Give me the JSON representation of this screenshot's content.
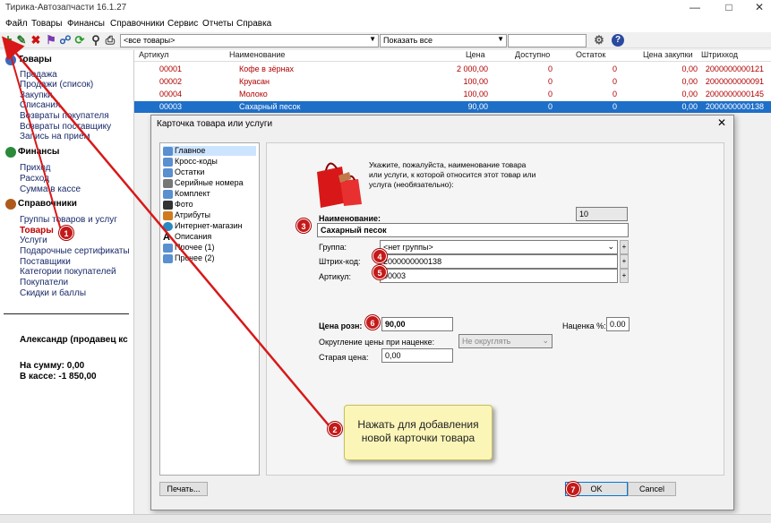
{
  "window": {
    "title": "Тирика-Автозапчасти 16.1.27"
  },
  "menu": [
    "Файл",
    "Товары",
    "Финансы",
    "Справочники",
    "Сервис",
    "Отчеты",
    "Справка"
  ],
  "toolbar": {
    "filter_value": "<все товары>",
    "show_value": "Показать все",
    "search_value": ""
  },
  "sidebar": {
    "sections": [
      {
        "title": "Товары",
        "items": [
          "Продажа",
          "Продажи (список)",
          "Закупки",
          "Списания",
          "Возвраты покупателя",
          "Возвраты поставщику",
          "Запись на прием"
        ]
      },
      {
        "title": "Финансы",
        "items": [
          "Приход",
          "Расход",
          "Сумма в кассе"
        ]
      },
      {
        "title": "Справочники",
        "items": [
          "Группы товаров и услуг",
          "Товары",
          "Услуги",
          "Подарочные сертификаты",
          "Поставщики",
          "Категории покупателей",
          "Покупатели",
          "Скидки и баллы"
        ]
      }
    ],
    "user": "Александр (продавец кс",
    "sum_label": "На сумму: 0,00",
    "cash_label": "В кассе: -1 850,00"
  },
  "grid": {
    "columns": [
      "Артикул",
      "Наименование",
      "Цена",
      "Доступно",
      "Остаток",
      "Цена закупки",
      "Штрихкод"
    ],
    "rows": [
      [
        "00001",
        "Кофе в зёрнах",
        "2 000,00",
        "0",
        "0",
        "0,00",
        "2000000000121"
      ],
      [
        "00002",
        "Круасан",
        "100,00",
        "0",
        "0",
        "0,00",
        "2000000000091"
      ],
      [
        "00004",
        "Молоко",
        "100,00",
        "0",
        "0",
        "0,00",
        "2000000000145"
      ],
      [
        "00003",
        "Сахарный песок",
        "90,00",
        "0",
        "0",
        "0,00",
        "2000000000138"
      ]
    ]
  },
  "dialog": {
    "title": "Карточка товара или услуги",
    "tree": [
      "Главное",
      "Кросс-коды",
      "Остатки",
      "Серийные номера",
      "Комплект",
      "Фото",
      "Атрибуты",
      "Интернет-магазин",
      "Описания",
      "Прочее (1)",
      "Прочее (2)"
    ],
    "hint": "Укажите, пожалуйста, наименование товара или услуги, к которой относится этот товар или услуга (необязательно):",
    "counter": "10",
    "name_label": "Наименование:",
    "name_value": "Сахарный песок",
    "group_label": "Группа:",
    "group_value": "<нет группы>",
    "barcode_label": "Штрих-код:",
    "barcode_value": "2000000000138",
    "article_label": "Артикул:",
    "article_value": "00003",
    "price_label": "Цена розн:",
    "price_value": "90,00",
    "markup_label": "Наценка %:",
    "markup_value": "0.00",
    "rounding_label": "Округление цены при наценке:",
    "rounding_value": "Не округлять",
    "old_price_label": "Старая цена:",
    "old_price_value": "0,00",
    "print_button": "Печать...",
    "ok_button": "OK",
    "cancel_button": "Cancel"
  },
  "callout": {
    "line1": "Нажать для добавления",
    "line2": "новой карточки товара"
  },
  "badges": [
    "1",
    "2",
    "3",
    "4",
    "5",
    "6",
    "7"
  ]
}
